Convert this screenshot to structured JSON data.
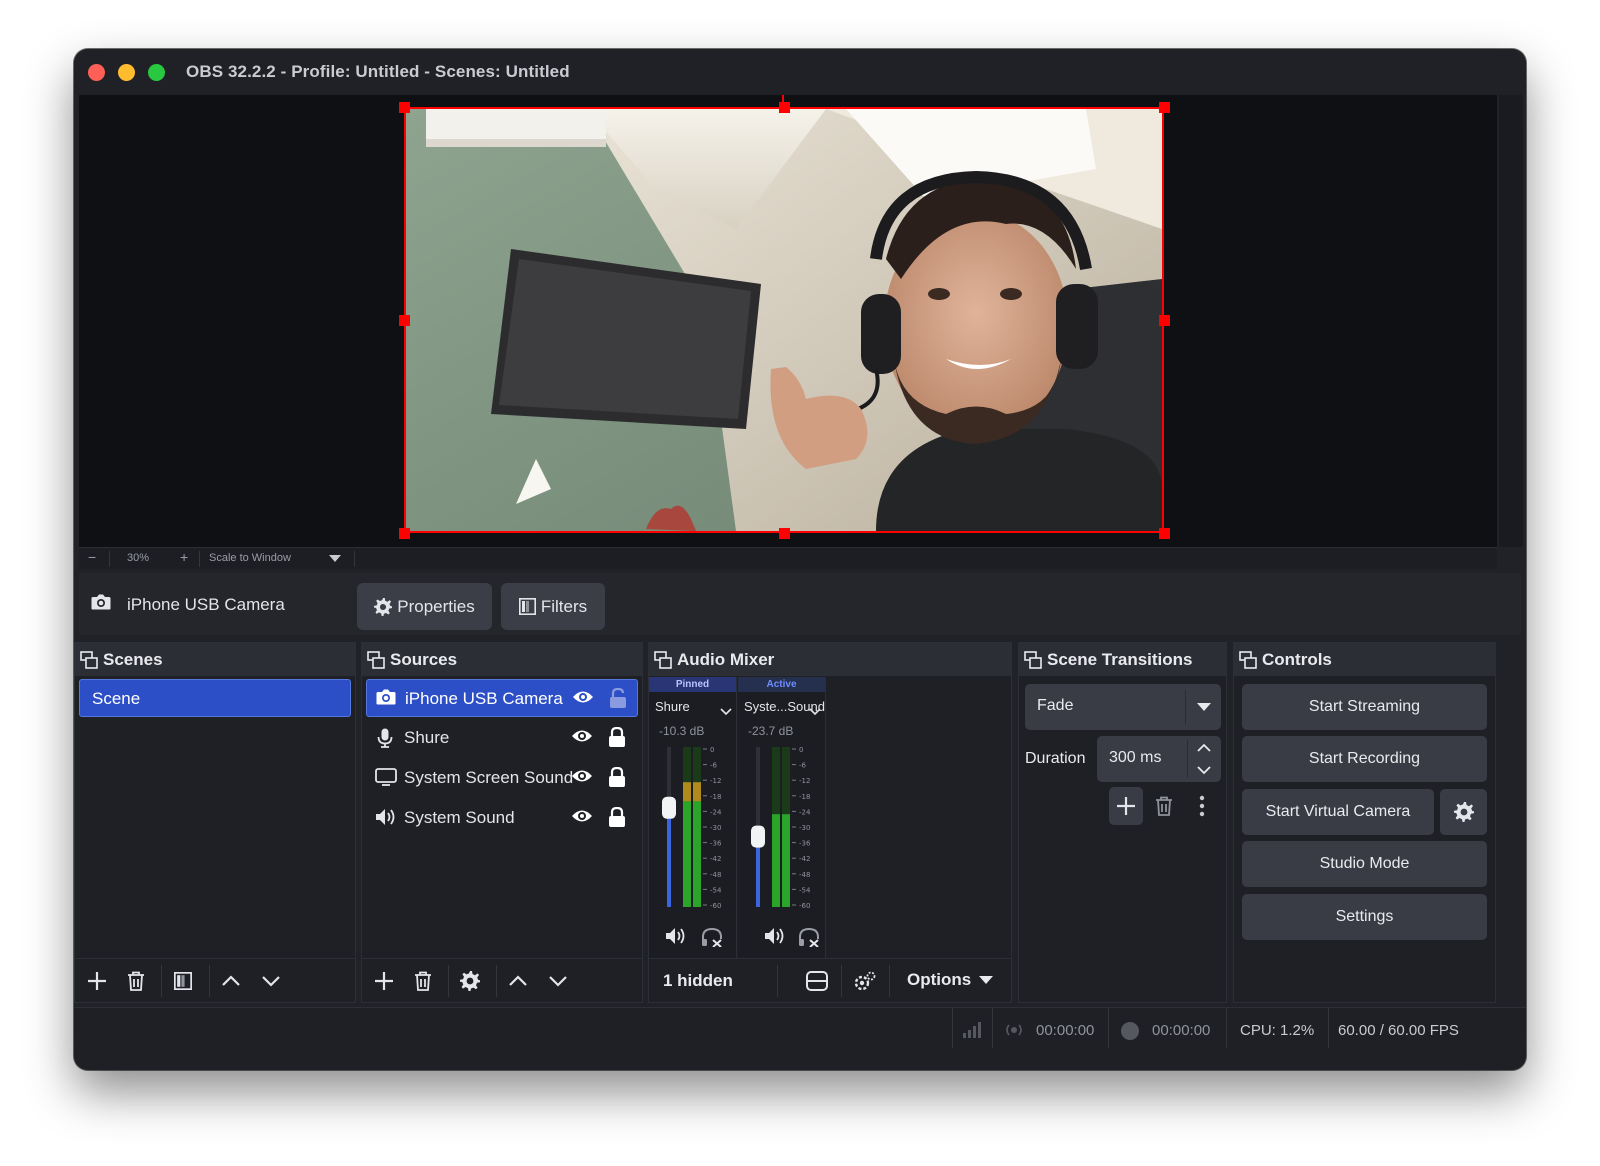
{
  "window": {
    "title": "OBS 32.2.2 - Profile: Untitled - Scenes: Untitled"
  },
  "zoom": {
    "minus": "−",
    "level": "30%",
    "plus": "+",
    "mode": "Scale to Window"
  },
  "context": {
    "source_name": "iPhone USB Camera",
    "properties_label": "Properties",
    "filters_label": "Filters"
  },
  "scenes": {
    "title": "Scenes",
    "items": [
      "Scene"
    ]
  },
  "sources": {
    "title": "Sources",
    "items": [
      {
        "label": "iPhone USB Camera",
        "icon": "camera-icon",
        "selected": true
      },
      {
        "label": "Shure",
        "icon": "microphone-icon",
        "selected": false
      },
      {
        "label": "System Screen Sound",
        "icon": "monitor-icon",
        "selected": false
      },
      {
        "label": "System Sound",
        "icon": "speaker-icon",
        "selected": false
      }
    ]
  },
  "mixer": {
    "title": "Audio Mixer",
    "channels": [
      {
        "tag": "Pinned",
        "name": "Shure",
        "db": "-10.3 dB",
        "fader_level": 0.62,
        "meter_level": 0.78
      },
      {
        "tag": "Active",
        "name": "Syste...Sound",
        "db": "-23.7 dB",
        "fader_level": 0.44,
        "meter_level": 0.58
      }
    ],
    "scale": [
      "0",
      "-6",
      "-12",
      "-18",
      "-24",
      "-30",
      "-36",
      "-42",
      "-48",
      "-54",
      "-60"
    ],
    "hidden_label": "1 hidden",
    "options_label": "Options"
  },
  "transitions": {
    "title": "Scene Transitions",
    "selected": "Fade",
    "duration_label": "Duration",
    "duration_value": "300 ms"
  },
  "controls": {
    "title": "Controls",
    "start_streaming": "Start Streaming",
    "start_recording": "Start Recording",
    "start_virtual_camera": "Start Virtual Camera",
    "studio_mode": "Studio Mode",
    "settings": "Settings"
  },
  "status": {
    "stream_time": "00:00:00",
    "record_time": "00:00:00",
    "cpu": "CPU: 1.2%",
    "fps": "60.00 / 60.00 FPS"
  },
  "colors": {
    "accent": "#2c4fc7",
    "selection_border": "#ff0000",
    "window_bg": "#202228"
  }
}
